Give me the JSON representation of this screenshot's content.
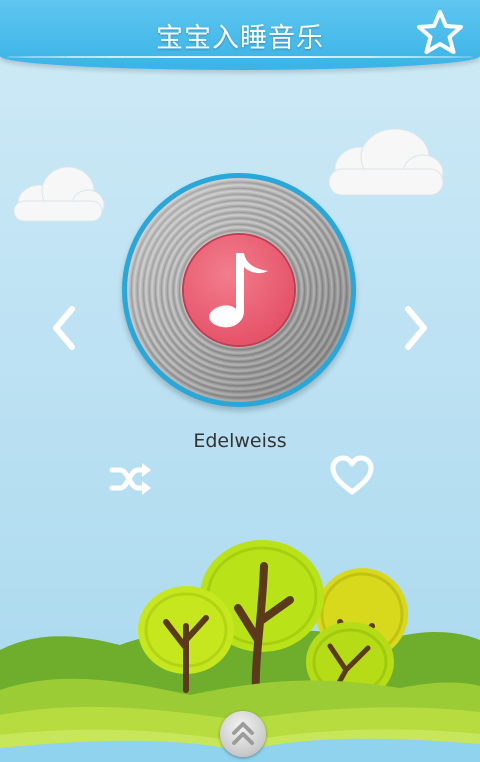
{
  "header": {
    "title": "宝宝入睡音乐",
    "favorite_icon": "star-outline-icon"
  },
  "player": {
    "song_title": "Edelweiss",
    "record_icon": "music-note-icon",
    "prev_icon": "chevron-left-icon",
    "next_icon": "chevron-right-icon",
    "shuffle_icon": "shuffle-icon",
    "like_icon": "heart-outline-icon"
  },
  "footer": {
    "expand_icon": "double-chevron-up-icon"
  },
  "colors": {
    "header": "#3ab3e6",
    "record_label": "#e6556a",
    "sky": "#bde2f3"
  }
}
